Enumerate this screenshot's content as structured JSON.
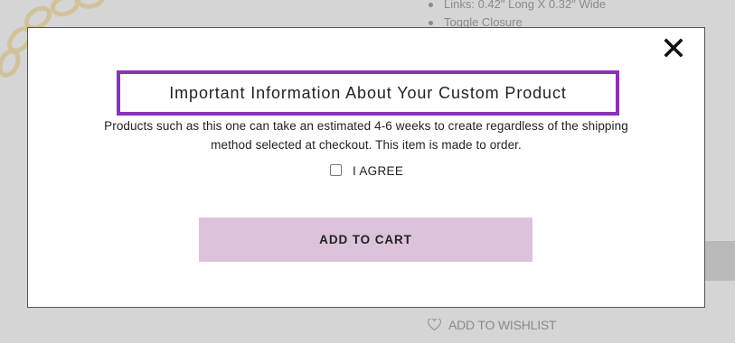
{
  "background": {
    "spec_items": [
      "Links: 0.42\" Long X 0.32\" Wide",
      "Toggle Closure"
    ],
    "wishlist_label": "ADD TO WISHLIST",
    "wishlist_icon": "heart-icon"
  },
  "modal": {
    "close_icon": "close-icon",
    "title": "Important Information About Your Custom Product",
    "message_line1": "Products such as this one can take an estimated 4-6 weeks to create regardless of the shipping",
    "message_line2": "method selected at checkout. This item is made to order.",
    "agree_label": "I AGREE",
    "agree_checked": false,
    "add_to_cart_label": "ADD TO CART",
    "colors": {
      "title_border": "#8e2fc0",
      "button_bg": "#dcc3d9"
    }
  }
}
